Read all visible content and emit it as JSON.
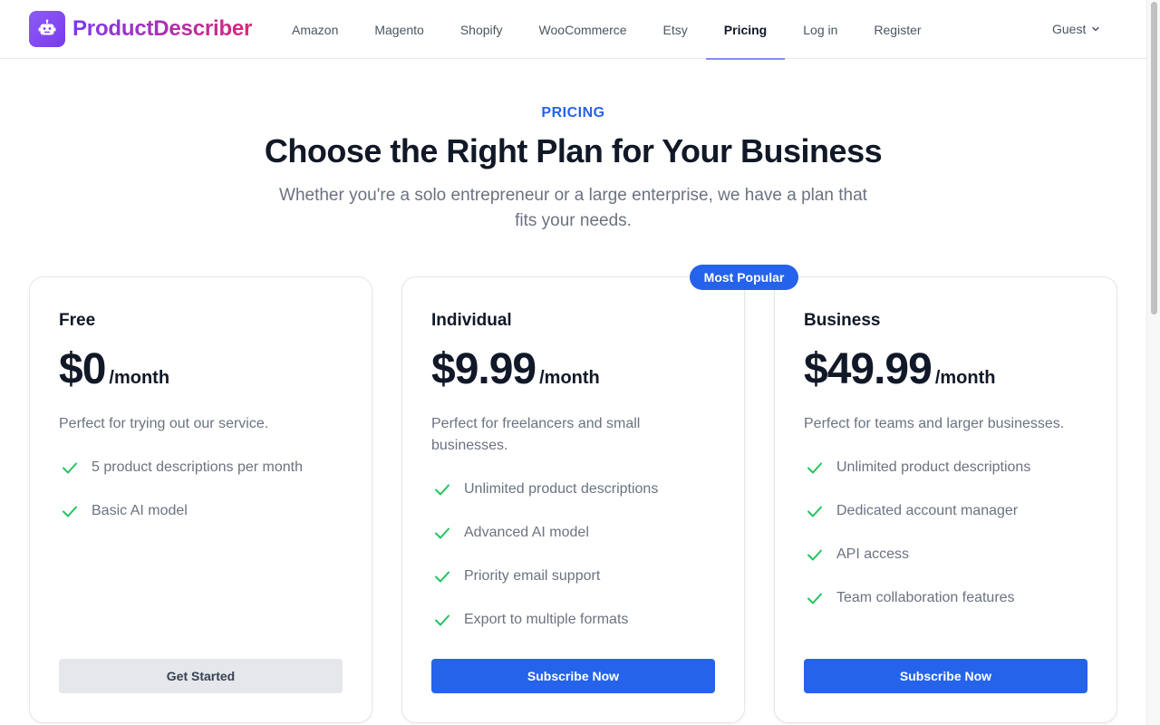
{
  "brand": {
    "name": "ProductDescriber",
    "icon": "robot-icon",
    "gradient_from": "#7c3aed",
    "gradient_to": "#db2777"
  },
  "nav": {
    "items": [
      {
        "label": "Amazon"
      },
      {
        "label": "Magento"
      },
      {
        "label": "Shopify"
      },
      {
        "label": "WooCommerce"
      },
      {
        "label": "Etsy"
      },
      {
        "label": "Pricing",
        "active": true
      },
      {
        "label": "Log in"
      },
      {
        "label": "Register"
      }
    ],
    "user_menu": {
      "label": "Guest",
      "icon": "chevron-down-icon"
    }
  },
  "hero": {
    "eyebrow": "PRICING",
    "title": "Choose the Right Plan for Your Business",
    "subtitle": "Whether you're a solo entrepreneur or a large enterprise, we have a plan that fits your needs."
  },
  "colors": {
    "accent": "#2563eb",
    "check": "#22c55e",
    "muted_text": "#6b7280"
  },
  "plans": [
    {
      "name": "Free",
      "price": "$0",
      "period": "/month",
      "description": "Perfect for trying out our service.",
      "features": [
        "5 product descriptions per month",
        "Basic AI model"
      ],
      "cta": "Get Started"
    },
    {
      "name": "Individual",
      "badge": "Most Popular",
      "price": "$9.99",
      "period": "/month",
      "description": "Perfect for freelancers and small businesses.",
      "features": [
        "Unlimited product descriptions",
        "Advanced AI model",
        "Priority email support",
        "Export to multiple formats"
      ],
      "cta": "Subscribe Now"
    },
    {
      "name": "Business",
      "price": "$49.99",
      "period": "/month",
      "description": "Perfect for teams and larger businesses.",
      "features": [
        "Unlimited product descriptions",
        "Dedicated account manager",
        "API access",
        "Team collaboration features"
      ],
      "cta": "Subscribe Now"
    }
  ]
}
